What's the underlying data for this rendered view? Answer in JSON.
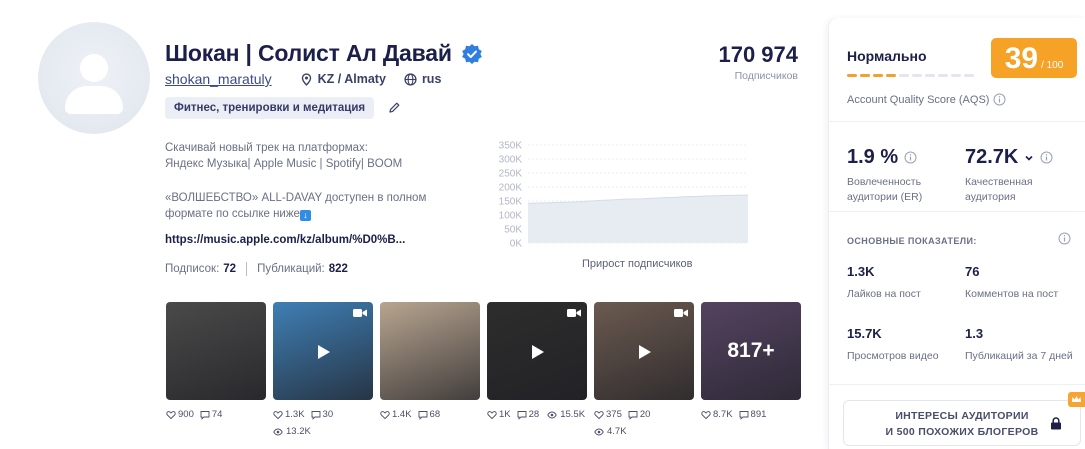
{
  "profile": {
    "name": "Шокан | Солист Ал Давай",
    "username": "shokan_maratuly",
    "location": "KZ / Almaty",
    "language": "rus",
    "category": "Фитнес, тренировки и медитация",
    "subscribers": "170 974",
    "subscribers_label": "Подписчиков",
    "bio_line1": "Скачивай новый трек на платформах:",
    "bio_line2": "Яндекс Музыка| Apple Music | Spotify| BOOM",
    "bio_line3": "«ВОЛШЕБСТВО» ALL-DAVAY доступен в полном",
    "bio_line4": "формате по ссылке ниже",
    "link": "https://music.apple.com/kz/album/%D0%B...",
    "following_label": "Подписок:",
    "following": "72",
    "posts_label": "Публикаций:",
    "posts": "822"
  },
  "chart_data": {
    "type": "area",
    "title": "Прирост подписчиков",
    "yticks": [
      "350K",
      "300K",
      "250K",
      "200K",
      "150K",
      "100K",
      "50K",
      "0K"
    ],
    "ylim": [
      0,
      350000
    ],
    "values": [
      142000,
      143000,
      144000,
      145000,
      146000,
      148000,
      150000,
      152000,
      154000,
      156000,
      157000,
      158000,
      160000,
      162000,
      163000,
      165000,
      166000,
      168000,
      169000,
      170000,
      170500,
      171000
    ],
    "grid": true,
    "colors": {
      "fill": "#e7ecf3",
      "line": "#d5dce7"
    }
  },
  "posts": [
    {
      "likes": "900",
      "comments": "74",
      "views": "",
      "video": false,
      "more": "",
      "bg": "#4a4a4a"
    },
    {
      "likes": "1.3K",
      "comments": "30",
      "views": "13.2K",
      "video": true,
      "more": "",
      "bg": "#3f7fb5"
    },
    {
      "likes": "1.4K",
      "comments": "68",
      "views": "",
      "video": false,
      "more": "",
      "bg": "#b8a590"
    },
    {
      "likes": "1K",
      "comments": "28",
      "views": "15.5K",
      "video": true,
      "more": "",
      "bg": "#2d2d2d"
    },
    {
      "likes": "375",
      "comments": "20",
      "views": "4.7K",
      "video": true,
      "more": "",
      "bg": "#6b5a50"
    },
    {
      "likes": "8.7K",
      "comments": "891",
      "views": "",
      "video": false,
      "more": "817+",
      "bg": "#7a5a86"
    }
  ],
  "panel": {
    "aqs_status": "Нормально",
    "aqs_score": "39",
    "aqs_max": "/ 100",
    "aqs_label": "Account Quality Score (AQS)",
    "aqs_level": 0.39,
    "er_value": "1.9 %",
    "er_label": "Вовлеченность аудитории (ER)",
    "qa_value": "72.7K",
    "qa_label": "Качественная аудитория",
    "section_title": "ОСНОВНЫЕ ПОКАЗАТЕЛИ:",
    "metrics": [
      {
        "value": "1.3K",
        "label": "Лайков на пост"
      },
      {
        "value": "76",
        "label": "Комментов на пост"
      },
      {
        "value": "15.7K",
        "label": "Просмотров видео"
      },
      {
        "value": "1.3",
        "label": "Публикаций за 7 дней"
      }
    ],
    "interests_line1": "ИНТЕРЕСЫ АУДИТОРИИ",
    "interests_line2": "И 500 ПОХОЖИХ БЛОГЕРОВ"
  },
  "colors": {
    "accent": "#f5a227",
    "verified": "#2f7fe0",
    "text": "#1b1f4a"
  }
}
